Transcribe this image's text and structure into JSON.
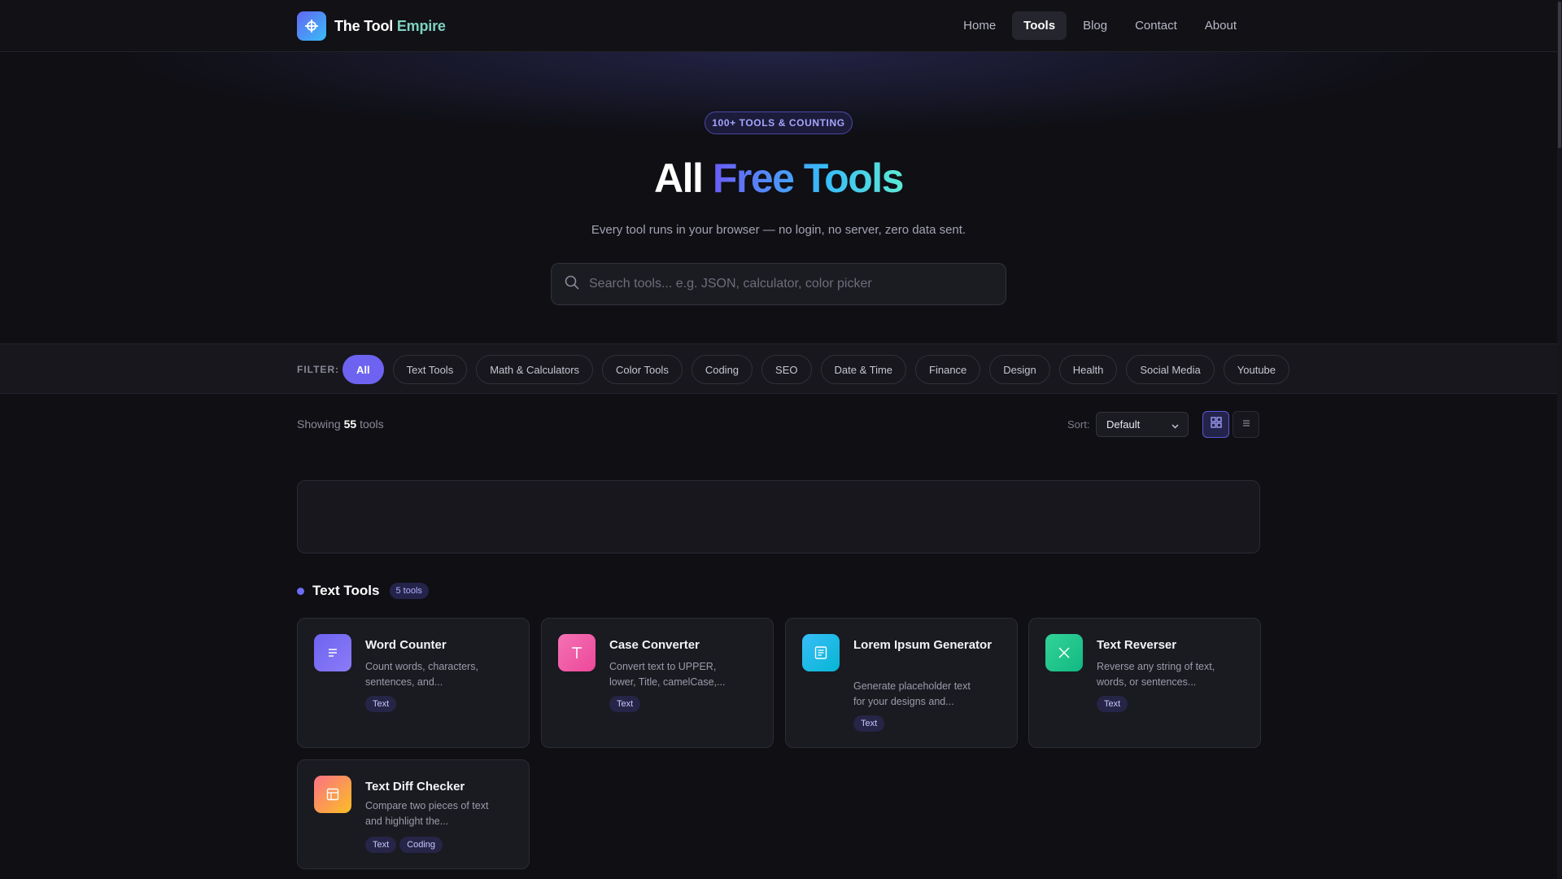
{
  "brand": {
    "name_part1": "The Tool",
    "name_part2": "Empire"
  },
  "nav": {
    "items": [
      "Home",
      "Tools",
      "Blog",
      "Contact",
      "About"
    ],
    "active": "Tools"
  },
  "hero": {
    "badge": "100+ TOOLS & COUNTING",
    "title_plain": "All",
    "title_gradient": "Free Tools",
    "subtitle": "Every tool runs in your browser — no login, no server, zero data sent."
  },
  "search": {
    "placeholder": "Search tools... e.g. JSON, calculator, color picker",
    "value": ""
  },
  "filter": {
    "label": "FILTER:",
    "chips": [
      "All",
      "Text Tools",
      "Math & Calculators",
      "Color Tools",
      "Coding",
      "SEO",
      "Date & Time",
      "Finance",
      "Design",
      "Health",
      "Social Media",
      "Youtube"
    ],
    "active": "All"
  },
  "results": {
    "prefix": "Showing",
    "count": "55",
    "suffix": "tools"
  },
  "sort": {
    "label": "Sort:",
    "value": "Default"
  },
  "view": {
    "active": "grid"
  },
  "section": {
    "title": "Text Tools",
    "count": "5 tools"
  },
  "cards": [
    {
      "title": "Word Counter",
      "desc": "Count words, characters, sentences, and...",
      "tags": [
        "Text"
      ],
      "icon": "lines-icon",
      "color": "#6366f1"
    },
    {
      "title": "Case Converter",
      "desc": "Convert text to UPPER, lower, Title, camelCase,...",
      "tags": [
        "Text"
      ],
      "icon": "letter-t-icon",
      "color": "#ec4899"
    },
    {
      "title": "Lorem Ipsum Generator",
      "desc": "Generate placeholder text for your designs and...",
      "tags": [
        "Text"
      ],
      "icon": "document-icon",
      "color": "#0ea5e9"
    },
    {
      "title": "Text Reverser",
      "desc": "Reverse any string of text, words, or sentences...",
      "tags": [
        "Text"
      ],
      "icon": "swap-icon",
      "color": "#10b981"
    },
    {
      "title": "Text Diff Checker",
      "desc": "Compare two pieces of text and highlight the...",
      "tags": [
        "Text",
        "Coding"
      ],
      "icon": "table-icon",
      "color": "#f97316"
    }
  ]
}
